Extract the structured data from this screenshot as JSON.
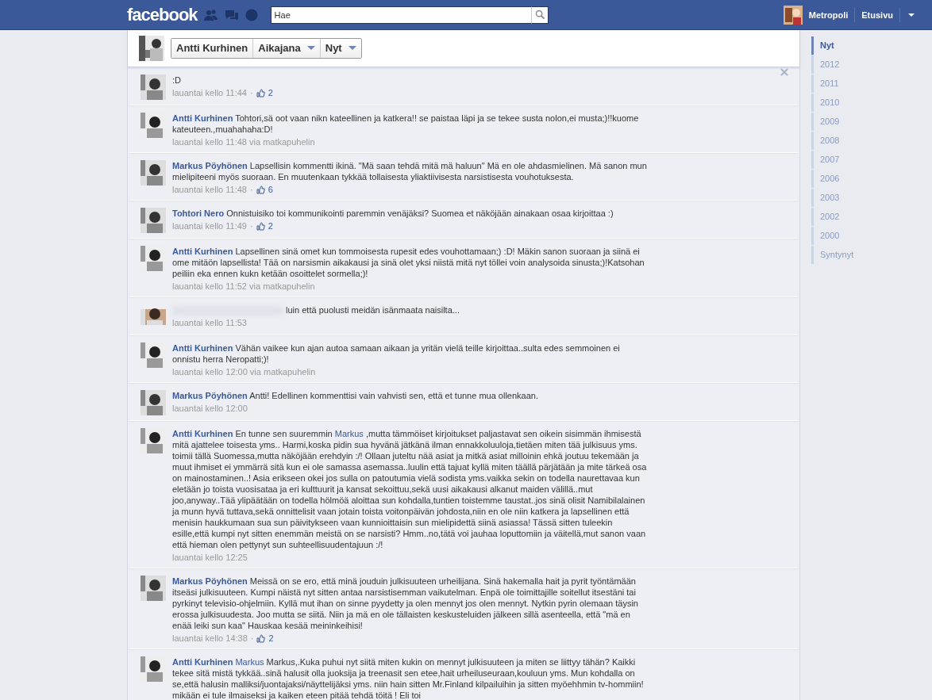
{
  "topbar": {
    "logo": "facebook",
    "search": {
      "placeholder": "Hae"
    },
    "user": "Metropoli",
    "home": "Etusivu"
  },
  "profile_header": {
    "name": "Antti Kurhinen",
    "menus": [
      "Aikajana",
      "Nyt"
    ]
  },
  "meta_separator": "·",
  "comments": [
    {
      "parts": [
        {
          "kind": "plain",
          "text": ":D"
        }
      ],
      "time": "lauantai kello 11:44",
      "likes": "2"
    },
    {
      "author": "Antti Kurhinen",
      "parts": [
        {
          "kind": "plain",
          "text": "Tohtori,sä oot vaan nikn kateellinen ja katkera!! se paistaa läpi ja se tekee susta nolon,ei musta;)!!kuome kateuteen.,muahahaha:D!"
        }
      ],
      "time": "lauantai kello 11:48",
      "via": "via matkapuhelin"
    },
    {
      "author": "Markus Pöyhönen",
      "parts": [
        {
          "kind": "plain",
          "text": "Lapsellisin kommentti ikinä. \"Mä saan tehdä mitä mä haluun\" Mä en ole ahdasmielinen. Mä sanon mun mielipiteeni myös suoraan. En muutenkaan tykkää tollaisesta yliaktiivisesta narsistisesta vouhotuksesta."
        }
      ],
      "time": "lauantai kello 11:48",
      "likes": "6"
    },
    {
      "author": "Tohtori Nero",
      "parts": [
        {
          "kind": "plain",
          "text": "Onnistuisiko toi kommunikointi paremmin venäjäksi? Suomea et näköjään ainakaan osaa kirjoittaa :)"
        }
      ],
      "time": "lauantai kello 11:49",
      "likes": "2"
    },
    {
      "author": "Antti Kurhinen",
      "parts": [
        {
          "kind": "plain",
          "text": "Lapsellinen sinä omet kun tommoisesta rupesit edes vouhottamaan;) :D! Mäkin sanon suoraan ja siinä ei ome mitäön lapsellista! Tää on narsismin aikakausi ja sinä olet yksi niistä mitä nyt töllei voin analysoida sinusta;)!Katsohan peiliin eka ennen kukn ketään osoittelet sormella;)!"
        }
      ],
      "time": "lauantai kello 11:52",
      "via": "via matkapuhelin"
    },
    {
      "blurred_author": true,
      "parts": [
        {
          "kind": "plain",
          "text": "luin että puolusti meidän isänmaata naisilta..."
        }
      ],
      "time": "lauantai kello 11:53"
    },
    {
      "author": "Antti Kurhinen",
      "parts": [
        {
          "kind": "plain",
          "text": "Vähän vaikee kun ajan autoa samaan aikaan ja yritän vielä teille kirjoittaa..sulta edes semmoinen ei onnistu herra Neropatti;)!"
        }
      ],
      "time": "lauantai kello 12:00",
      "via": "via matkapuhelin"
    },
    {
      "author": "Markus Pöyhönen",
      "parts": [
        {
          "kind": "plain",
          "text": "Antti! Edellinen kommenttisi vain vahvisti sen, että et tunne mua ollenkaan."
        }
      ],
      "time": "lauantai kello 12:00"
    },
    {
      "author": "Antti Kurhinen",
      "parts": [
        {
          "kind": "plain",
          "text": "En tunne sen suuremmin "
        },
        {
          "kind": "mention",
          "text": "Markus"
        },
        {
          "kind": "plain",
          "text": " ,mutta tämmöiset kirjoitukset paljastavat sen oikein sisimmän ihmisestä mitä ajattelee toisesta yms.. Harmi,koska pidin sua hyvänä jätkänä ilman ennakkoluuloja,tietäen miten tää julkisuus yms. toimii tällä Suomessa,mutta näköjään erehdyin :/! Ollaan juteltu nää asiat ja mitkä asiat milloinin ehkä joutuu tekemään ja muut ihmiset ei ymmärrä sitä kun ei ole samassa asemassa..luulin että tajuat kyllä miten täällä pärjätään ja mite tärkeä osa on mainostaminen..! Asia erikseen okei jos sulla on patoutumia vielä sodista yms.vaikka sekin on todella naurettavaa kun eletään jo toista vuosisataa ja eri kulttuurit ja kansat sekoittuu,sekä uusi aikakausi alkanut maiden välillä..mut joo,anyway..Tää ylipäätään on todella hölmöä aloittaa sun kohdalla,tuntien toistemme taustat..jos sinä olisit Namibilalainen ja munn hyvä tuttava,sekä onnittelisit vaan jotain toista voitonpäivän johdosta,niin en ole niin katkera ja lapsellinen että menisin haukkumaan sua sun päivitykseen vaan kunnioittaisin sun mielipidettä siinä asiassa! Tässä sitten tuleekin esille,että kumpi nyt sitten enemmän meistä on se narsisti? Hmm..no,tätä voi jauhaa loputtomiin ja väitellä,mut sanon vaan että hieman olen pettynyt sun suhteellisuudentajuun :/!"
        }
      ],
      "time": "lauantai kello 12:25"
    },
    {
      "author": "Markus Pöyhönen",
      "parts": [
        {
          "kind": "plain",
          "text": "Meissä on se ero, että minä jouduin julkisuuteen urheilijana. Sinä hakemalla hait ja pyrit työntämään itseäsi julkisuuteen. Kumpi näistä nyt sitten antaa narsistisemman vaikutelman. Enpä ole toimittajille soitellut itsestäni tai pyrkinyt televisio-ohjelmiin. Kyllä mut ihan on sinne pyydetty ja olen mennyt jos olen mennyt. Nytkin pyrin olemaan täysin erossa julkisuudesta. Joo mutta se siitä. Niin ja mä en ole tällaisten keskusteluiden jälkeen sillä asenteella, että \"mä en enää leiki sun kaa\" Hauskaa kesää meininkeihisi!"
        }
      ],
      "time": "lauantai kello 14:38",
      "likes": "2"
    },
    {
      "author": "Antti Kurhinen",
      "parts": [
        {
          "kind": "mention",
          "text": "Markus"
        },
        {
          "kind": "plain",
          "text": " Markus,.Kuka puhui nyt siitä miten kukin on mennyt julkisuuteen ja miten se liittyy tähän? Kaikki tekee sitä mistä tykkää..sinä halusit olla juoksija ja treenasit sen etee,hait urheiluseuraan,kouluun yms. Mun kohdalla on se,että halusin malliksi/juontajaksi/näyttelijäksi yms. niin hain sitten Mr.Finland kilpailuihin ja sitten myöehhmin tv-hommiin! mikään ei tule ilmaiseksi ja kaiken eteen pitää tehdä töitä ! Eli toi"
        }
      ]
    }
  ],
  "timeline": [
    {
      "label": "Nyt",
      "selected": true
    },
    {
      "label": "2012",
      "selected": false
    },
    {
      "label": "2011",
      "selected": false
    },
    {
      "label": "2010",
      "selected": false
    },
    {
      "label": "2009",
      "selected": false
    },
    {
      "label": "2008",
      "selected": false
    },
    {
      "label": "2007",
      "selected": false
    },
    {
      "label": "2006",
      "selected": false
    },
    {
      "label": "2003",
      "selected": false
    },
    {
      "label": "2002",
      "selected": false
    },
    {
      "label": "2000",
      "selected": false
    },
    {
      "label": "Syntynyt",
      "selected": false
    }
  ]
}
